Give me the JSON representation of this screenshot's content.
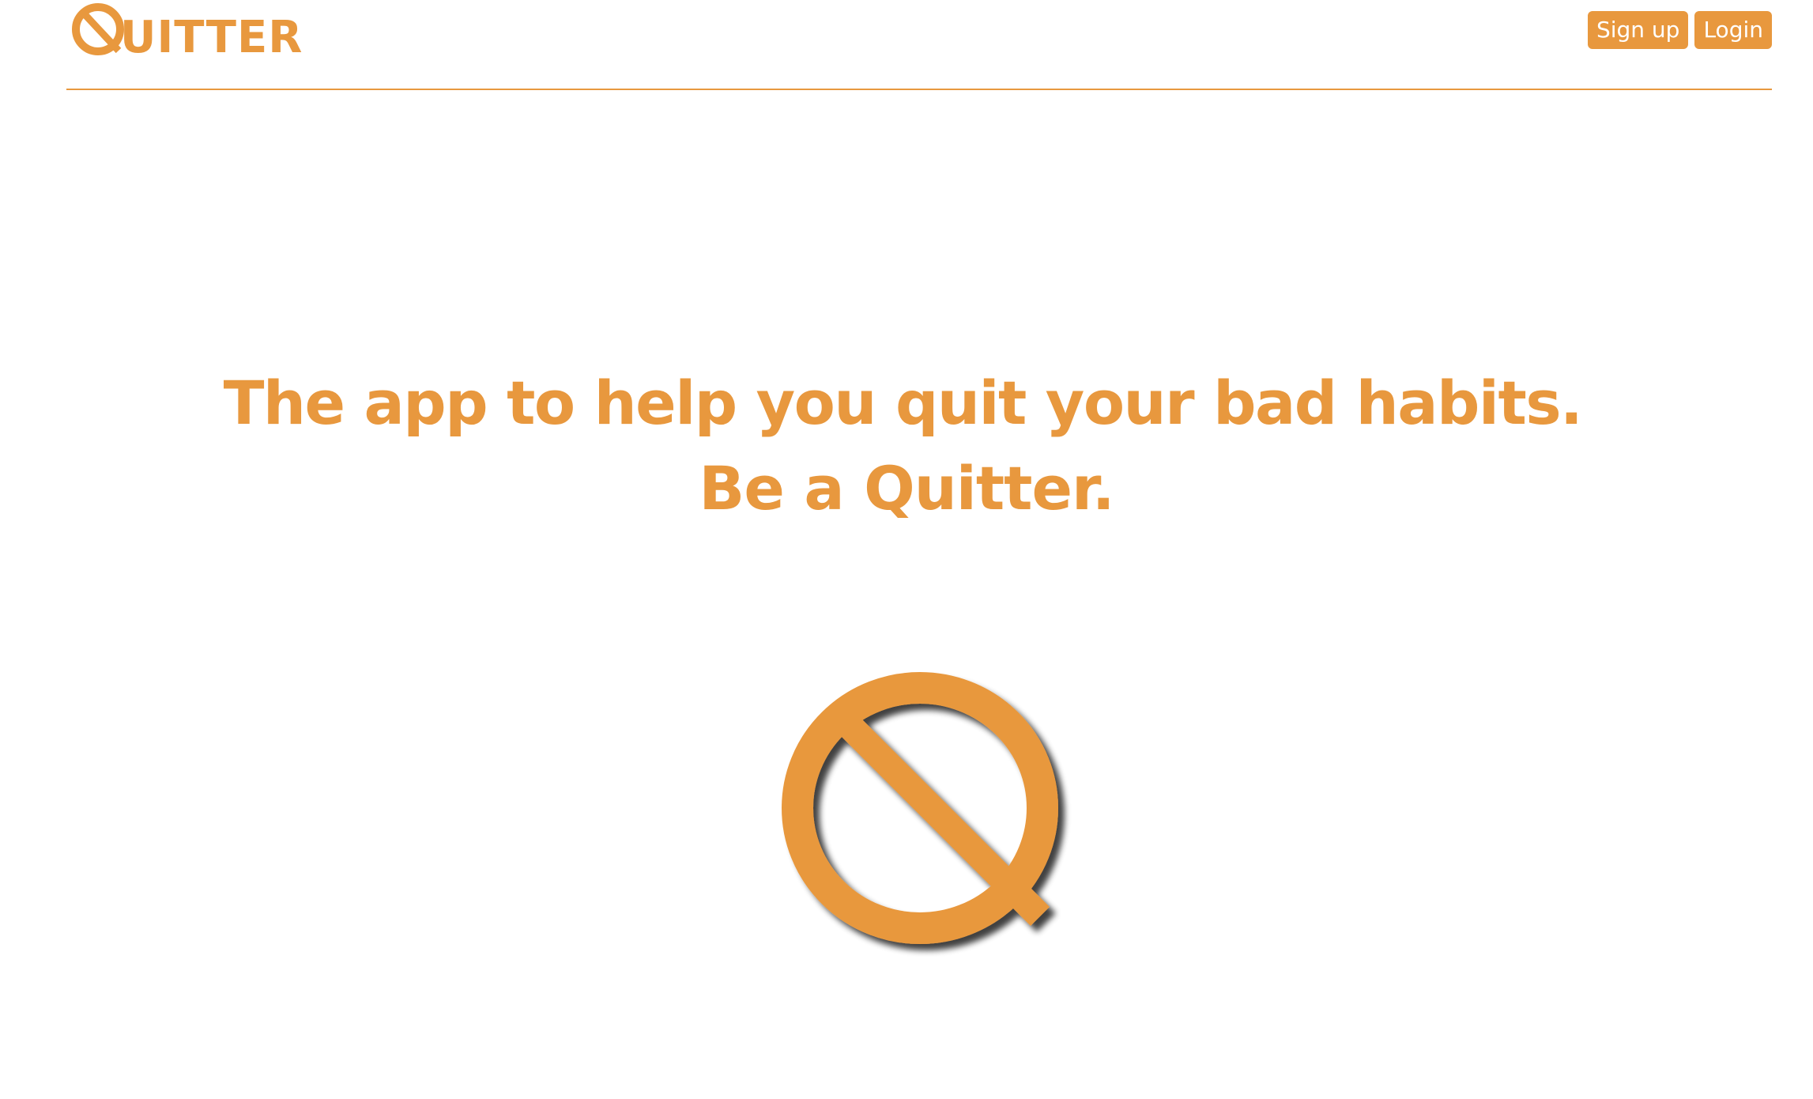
{
  "header": {
    "brand_name": "UITTER",
    "brand_icon": "quitter-q-logo",
    "signup_label": "Sign up",
    "login_label": "Login"
  },
  "hero": {
    "line1": "The app to help you quit your bad habits.",
    "line2": "Be a Quitter.",
    "logo_icon": "quitter-q-logo"
  },
  "colors": {
    "brand": "#E8983E",
    "background": "#FFFFFF",
    "button_text": "#FFFFFF"
  }
}
